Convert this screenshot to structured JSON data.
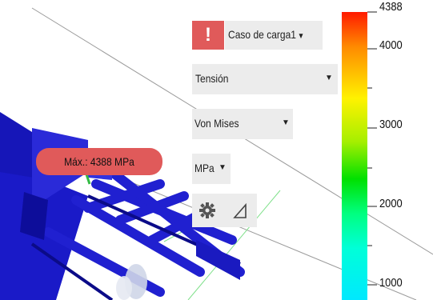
{
  "result_panel": {
    "load_case": "Caso de carga1",
    "result_type": "Tensión",
    "component": "Von Mises",
    "unit": "MPa"
  },
  "probe": {
    "max_label": "Máx.: 4388 MPa"
  },
  "legend": {
    "ticks": [
      "4388",
      "4000",
      "3000",
      "2000",
      "1000"
    ],
    "max_color": "#ff1a00",
    "min_color": "#00e8ff"
  },
  "icons": {
    "warning": "!",
    "settings": "gear-icon",
    "probe_tool": "triangle-icon"
  }
}
